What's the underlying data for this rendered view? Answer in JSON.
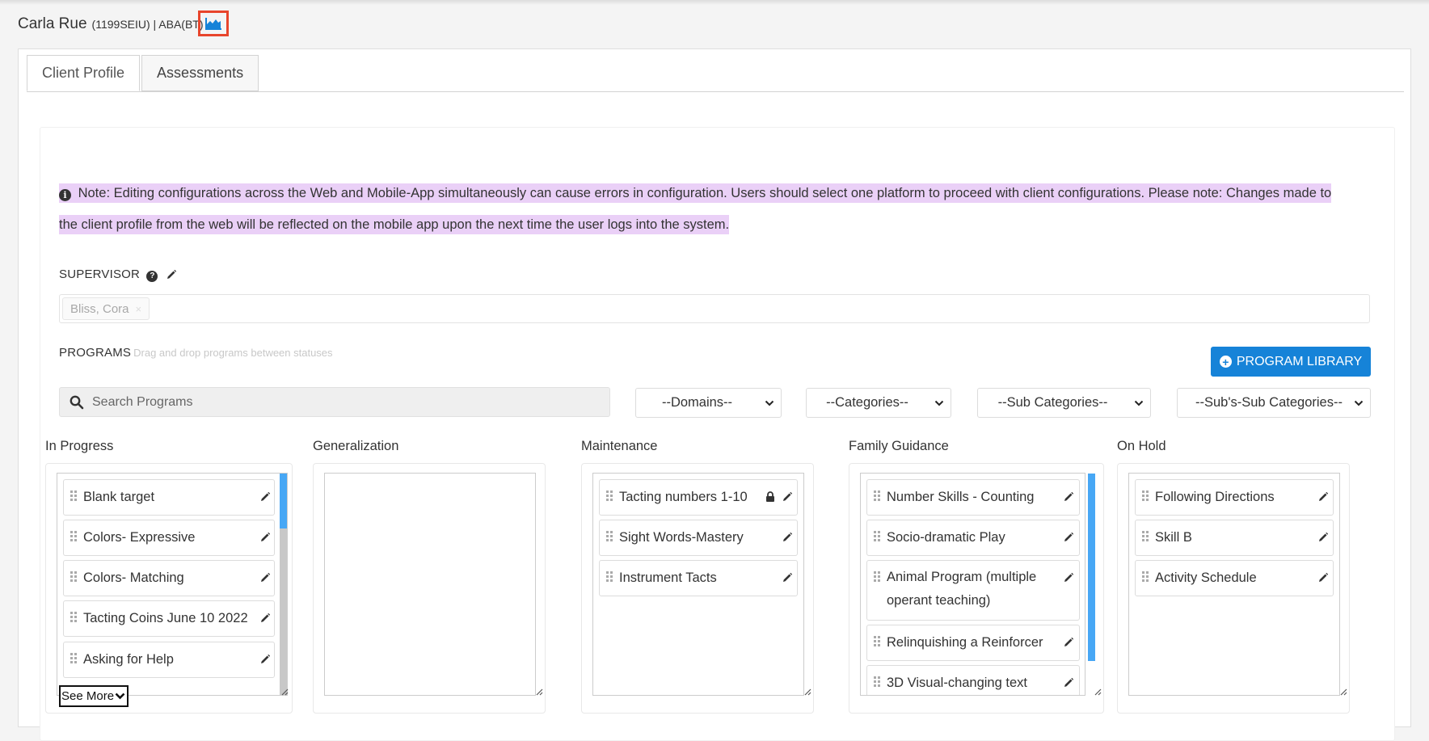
{
  "header": {
    "client_name": "Carla Rue",
    "client_meta": "(1199SEIU) | ABA(BT)",
    "chart_icon": "area-chart-icon"
  },
  "tabs": [
    {
      "label": "Client Profile",
      "active": true
    },
    {
      "label": "Assessments",
      "active": false
    }
  ],
  "note": {
    "icon": "info-circle-icon",
    "text": "Note: Editing configurations across the Web and Mobile-App simultaneously can cause errors in configuration. Users should select one platform to proceed with client configurations. Please note: Changes made to the client profile from the web will be reflected on the mobile app upon the next time the user logs into the system.",
    "highlight_color": "#ead0f7"
  },
  "supervisor": {
    "label": "SUPERVISOR",
    "selected": "Bliss, Cora",
    "remove": "×"
  },
  "programs": {
    "label": "PROGRAMS",
    "hint": "Drag and drop programs between statuses",
    "library_button": "PROGRAM LIBRARY",
    "search_placeholder": "Search Programs",
    "filters": [
      "--Domains--",
      "--Categories--",
      "--Sub Categories--",
      "--Sub's-Sub Categories--"
    ]
  },
  "columns": [
    {
      "title": "In Progress",
      "items": [
        "Blank target",
        "Colors- Expressive",
        "Colors- Matching",
        "Tacting Coins June 10 2022",
        "Asking for Help"
      ]
    },
    {
      "title": "Generalization",
      "items": []
    },
    {
      "title": "Maintenance",
      "items": [
        "Tacting numbers 1-10",
        "Sight Words-Mastery",
        "Instrument Tacts"
      ]
    },
    {
      "title": "Family Guidance",
      "items": [
        "Number Skills - Counting",
        "Socio-dramatic Play",
        "Animal Program (multiple operant teaching)",
        "Relinquishing a Reinforcer",
        "3D Visual-changing text"
      ]
    },
    {
      "title": "On Hold",
      "items": [
        "Following Directions",
        "Skill B",
        "Activity Schedule"
      ]
    }
  ],
  "see_more": "See More",
  "colors": {
    "accent": "#1683d8",
    "scroll_thumb": "#47a7f5",
    "highlight_box": "#e8452c"
  }
}
